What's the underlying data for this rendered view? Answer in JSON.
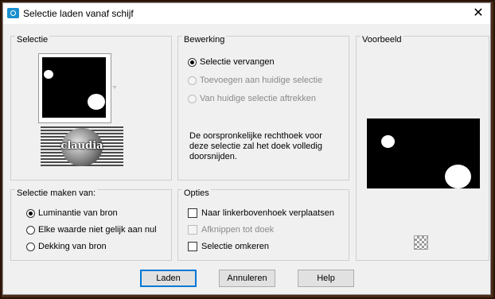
{
  "window": {
    "title": "Selectie laden vanaf schijf",
    "close_glyph": "✕"
  },
  "selectie": {
    "label": "Selectie",
    "thumb_text": "claudia"
  },
  "bewerking": {
    "label": "Bewerking",
    "options": [
      {
        "label": "Selectie vervangen",
        "selected": true,
        "enabled": true
      },
      {
        "label": "Toevoegen aan huidige selectie",
        "selected": false,
        "enabled": false
      },
      {
        "label": "Van huidige selectie aftrekken",
        "selected": false,
        "enabled": false
      }
    ],
    "description": [
      "De oorspronkelijke rechthoek voor",
      "deze selectie zal het doek volledig",
      "doorsnijden."
    ]
  },
  "voorbeeld": {
    "label": "Voorbeeld"
  },
  "maken": {
    "label": "Selectie maken van:",
    "options": [
      {
        "label": "Luminantie van bron",
        "selected": true
      },
      {
        "label": "Elke waarde niet gelijk aan nul",
        "selected": false
      },
      {
        "label": "Dekking van bron",
        "selected": false
      }
    ]
  },
  "opties": {
    "label": "Opties",
    "options": [
      {
        "label": "Naar linkerbovenhoek verplaatsen",
        "checked": false,
        "enabled": true
      },
      {
        "label": "Afknippen tot doek",
        "checked": false,
        "enabled": false
      },
      {
        "label": "Selectie omkeren",
        "checked": false,
        "enabled": true
      }
    ]
  },
  "buttons": {
    "load": "Laden",
    "cancel": "Annuleren",
    "help": "Help"
  }
}
